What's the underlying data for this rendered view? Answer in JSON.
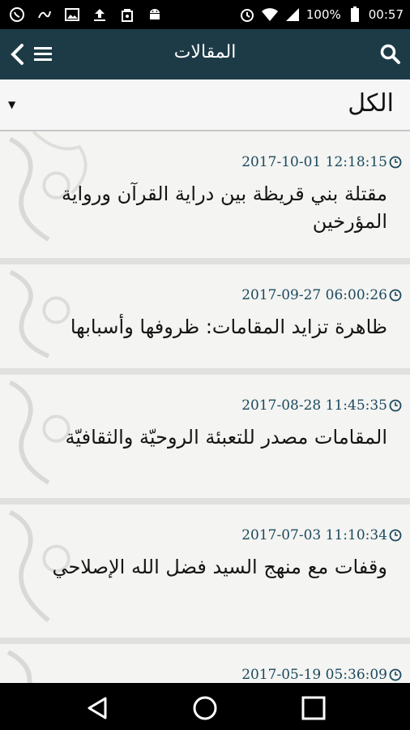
{
  "status_bar": {
    "battery": "100%",
    "time": "00:57"
  },
  "app_bar": {
    "title": "المقالات"
  },
  "filter": {
    "selected": "الكل"
  },
  "articles": [
    {
      "date": "2017-10-01 12:18:15",
      "title": "مقتلة بني قريظة بين دراية القرآن ورواية المؤرخين"
    },
    {
      "date": "2017-09-27 06:00:26",
      "title": "ظاهرة تزايد المقامات: ظروفها وأسبابها"
    },
    {
      "date": "2017-08-28 11:45:35",
      "title": "المقامات مصدر للتعبئة الروحيّة والثقافيّة"
    },
    {
      "date": "2017-07-03 11:10:34",
      "title": "وقفات مع منهج السيد فضل الله الإصلاحي"
    },
    {
      "date": "2017-05-19 05:36:09",
      "title": ""
    }
  ],
  "colors": {
    "app_bar": "#1d3b47",
    "date_text": "#1c4a5e"
  }
}
